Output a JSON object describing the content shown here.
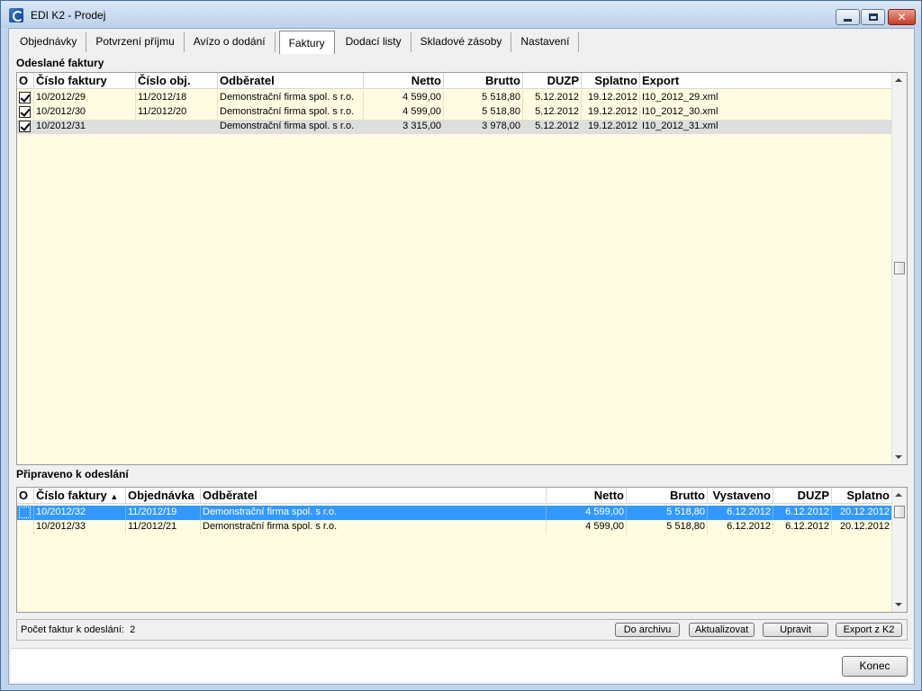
{
  "window": {
    "title": "EDI K2 - Prodej"
  },
  "tabs": [
    {
      "label": "Objednávky",
      "active": false
    },
    {
      "label": "Potvrzení příjmu",
      "active": false
    },
    {
      "label": "Avízo o dodání",
      "active": false
    },
    {
      "label": "Faktury",
      "active": true
    },
    {
      "label": "Dodací listy",
      "active": false
    },
    {
      "label": "Skladové zásoby",
      "active": false
    },
    {
      "label": "Nastavení",
      "active": false
    }
  ],
  "sent": {
    "label": "Odeslané faktury",
    "columns": [
      "O",
      "Číslo faktury",
      "Číslo obj.",
      "Odběratel",
      "Netto",
      "Brutto",
      "DUZP",
      "Splatno",
      "Export"
    ],
    "rows": [
      {
        "invoice": "10/2012/29",
        "order": "11/2012/18",
        "customer": "Demonstrační firma spol. s r.o.",
        "netto": "4 599,00",
        "brutto": "5 518,80",
        "duzp": "5.12.2012",
        "due": "19.12.2012",
        "export": "I10_2012_29.xml"
      },
      {
        "invoice": "10/2012/30",
        "order": "11/2012/20",
        "customer": "Demonstrační firma spol. s r.o.",
        "netto": "4 599,00",
        "brutto": "5 518,80",
        "duzp": "5.12.2012",
        "due": "19.12.2012",
        "export": "I10_2012_30.xml"
      },
      {
        "invoice": "10/2012/31",
        "order": "",
        "customer": "Demonstrační firma spol. s r.o.",
        "netto": "3 315,00",
        "brutto": "3 978,00",
        "duzp": "5.12.2012",
        "due": "19.12.2012",
        "export": "I10_2012_31.xml"
      }
    ]
  },
  "ready": {
    "label": "Připraveno k odeslání",
    "columns": [
      "O",
      "Číslo faktury",
      "Objednávka",
      "Odběratel",
      "Netto",
      "Brutto",
      "Vystaveno",
      "DUZP",
      "Splatno"
    ],
    "rows": [
      {
        "invoice": "10/2012/32",
        "order": "11/2012/19",
        "customer": "Demonstrační firma spol. s r.o.",
        "netto": "4 599,00",
        "brutto": "5 518,80",
        "issued": "6.12.2012",
        "duzp": "6.12.2012",
        "due": "20.12.2012"
      },
      {
        "invoice": "10/2012/33",
        "order": "11/2012/21",
        "customer": "Demonstrační firma spol. s r.o.",
        "netto": "4 599,00",
        "brutto": "5 518,80",
        "issued": "6.12.2012",
        "duzp": "6.12.2012",
        "due": "20.12.2012"
      }
    ]
  },
  "status": {
    "count_label": "Počet faktur k odeslání:",
    "count_value": "2"
  },
  "buttons": {
    "archive": "Do archivu",
    "refresh": "Aktualizovat",
    "edit": "Upravit",
    "export": "Export z K2",
    "close": "Konec"
  }
}
